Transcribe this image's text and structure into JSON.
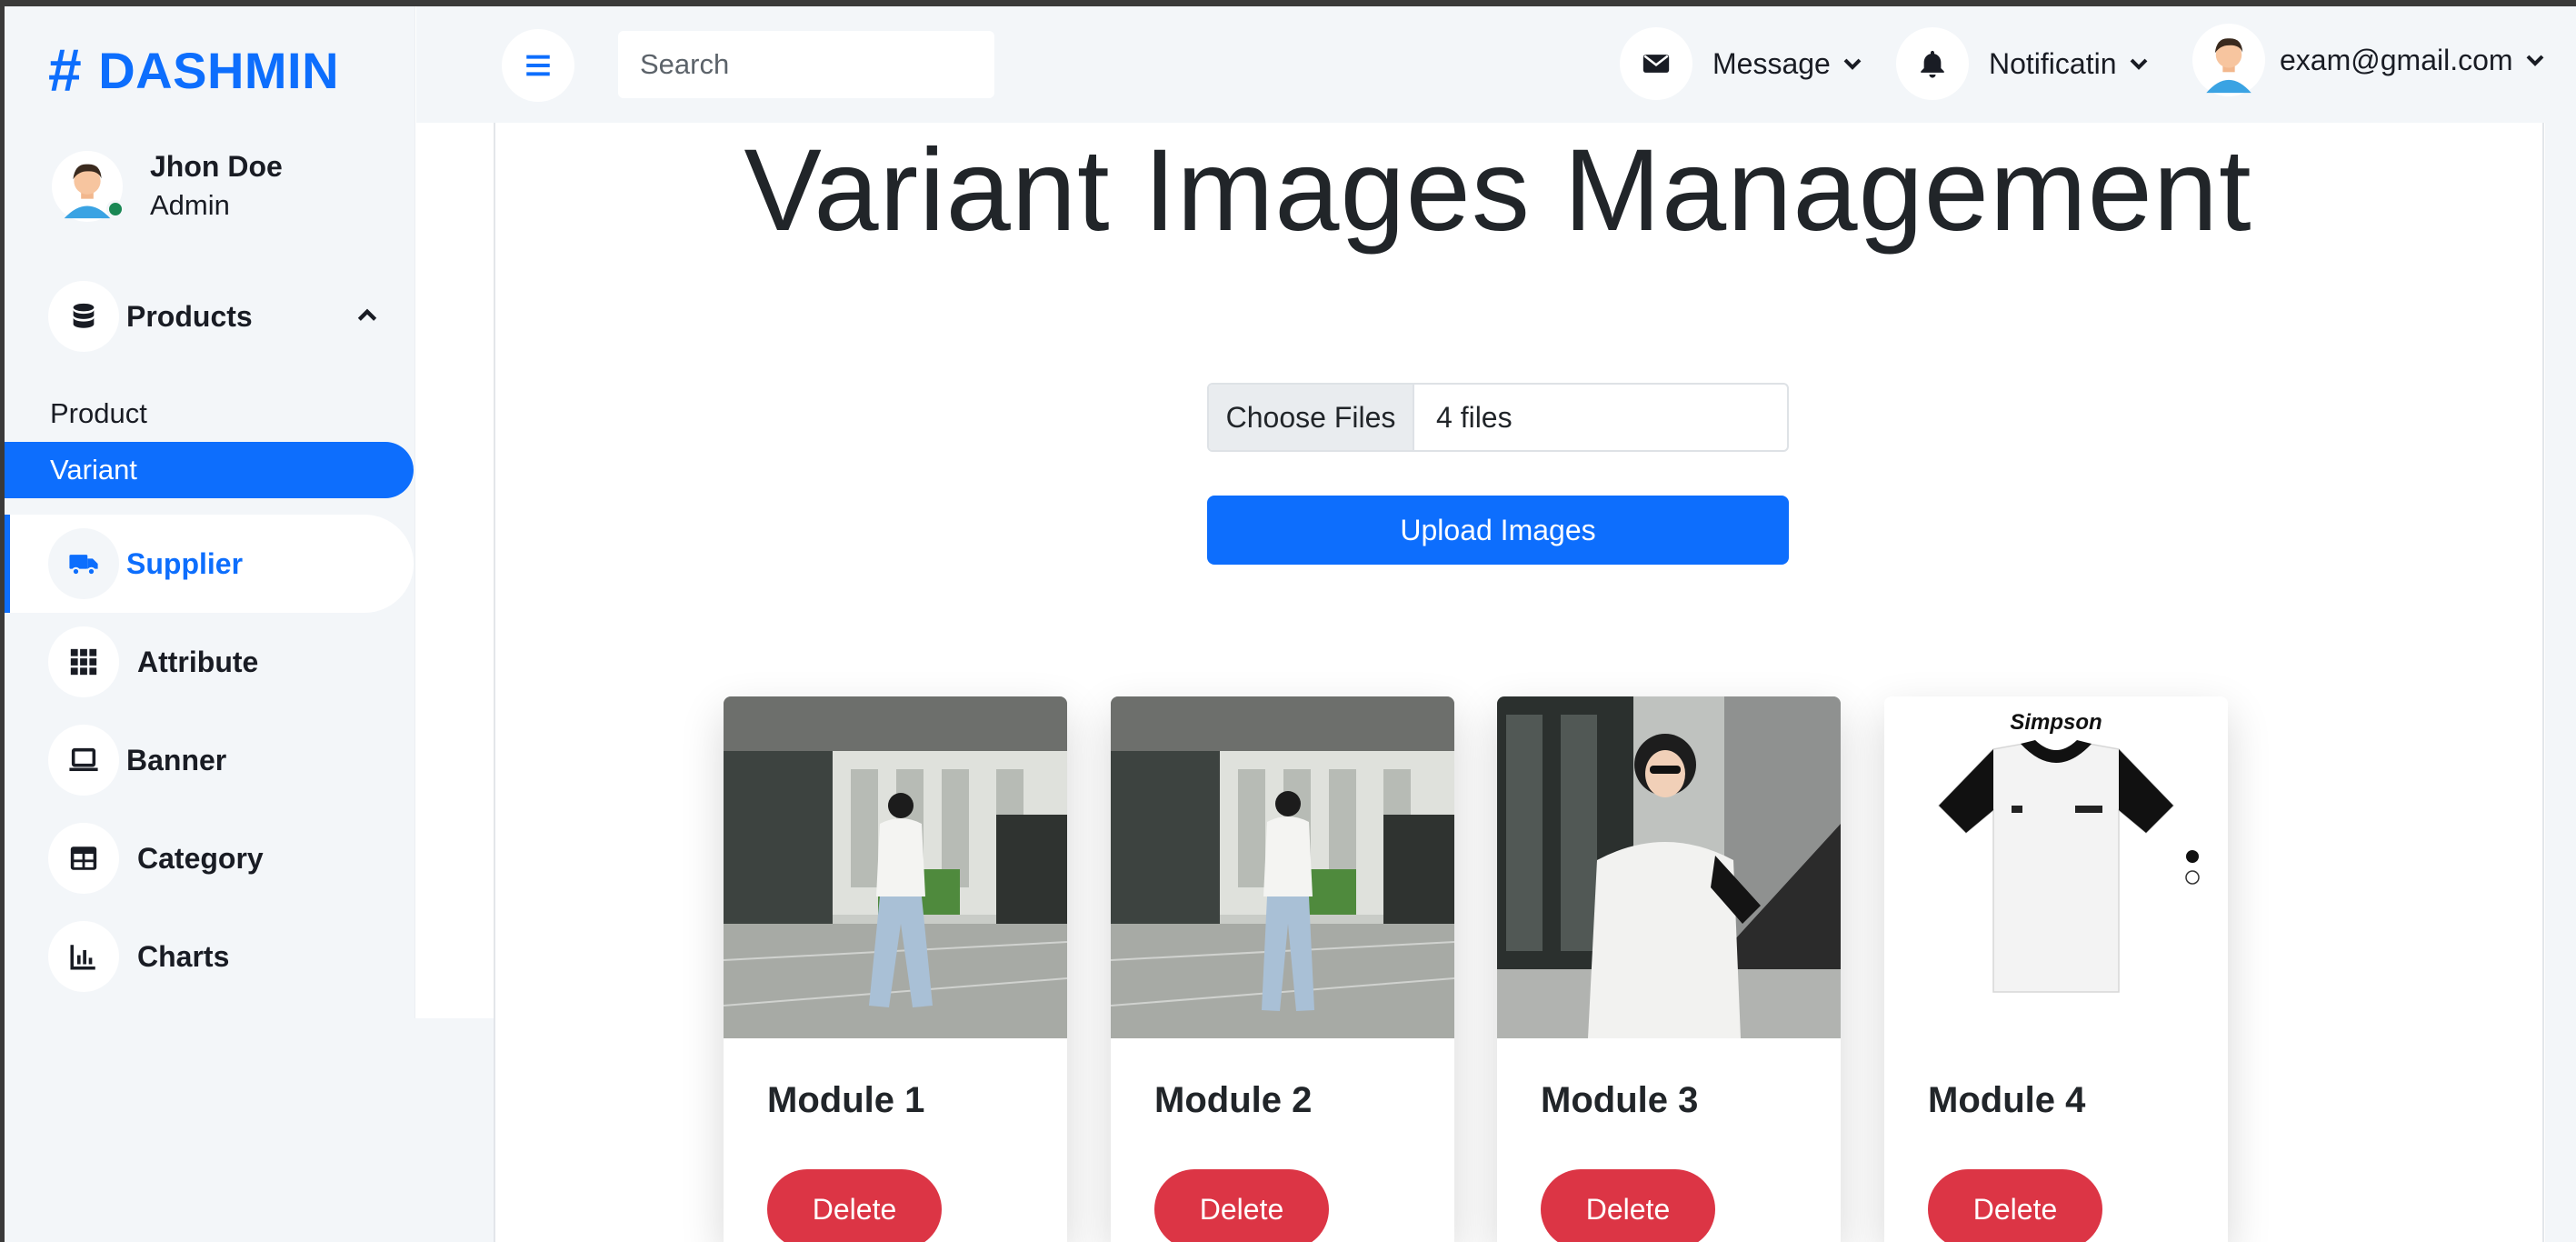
{
  "brand": {
    "hash": "#",
    "name": "DASHMIN"
  },
  "user": {
    "name": "Jhon Doe",
    "role": "Admin"
  },
  "sidebar": {
    "products_label": "Products",
    "sub_items": [
      "Product",
      "Variant"
    ],
    "items": [
      {
        "label": "Supplier",
        "icon": "truck-icon"
      },
      {
        "label": "Attribute",
        "icon": "grid-icon"
      },
      {
        "label": "Banner",
        "icon": "laptop-icon"
      },
      {
        "label": "Category",
        "icon": "table-icon"
      },
      {
        "label": "Charts",
        "icon": "chart-icon"
      }
    ]
  },
  "navbar": {
    "search_placeholder": "Search",
    "message_label": "Message",
    "notification_label": "Notificatin",
    "account_label": "exam@gmail.com"
  },
  "main": {
    "title": "Variant Images Management",
    "file_button": "Choose Files",
    "file_status": "4 files",
    "upload_label": "Upload Images",
    "delete_label": "Delete",
    "cards": [
      {
        "title": "Module 1"
      },
      {
        "title": "Module 2"
      },
      {
        "title": "Module 3"
      },
      {
        "title": "Module 4",
        "image_brand_text": "Simpson"
      }
    ]
  },
  "colors": {
    "primary": "#0d6efd",
    "danger": "#dc3545",
    "sidebar_bg": "#f3f6f9",
    "online": "#198754"
  }
}
